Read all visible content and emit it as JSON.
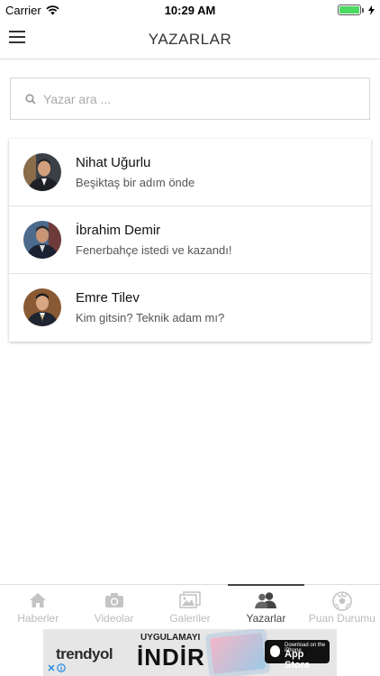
{
  "status_bar": {
    "carrier": "Carrier",
    "time": "10:29 AM",
    "battery_color": "#4cd964"
  },
  "nav": {
    "title": "YAZARLAR",
    "menu_icon": "hamburger-icon"
  },
  "search": {
    "placeholder": "Yazar ara ...",
    "icon": "search-icon"
  },
  "authors": [
    {
      "name": "Nihat Uğurlu",
      "article": "Beşiktaş bir adım önde"
    },
    {
      "name": "İbrahim Demir",
      "article": "Fenerbahçe istedi ve kazandı!"
    },
    {
      "name": "Emre Tilev",
      "article": "Kim gitsin? Teknik adam mı?"
    }
  ],
  "tabs": [
    {
      "label": "Haberler",
      "icon": "home-icon",
      "active": false
    },
    {
      "label": "Videolar",
      "icon": "camera-icon",
      "active": false
    },
    {
      "label": "Galeriler",
      "icon": "gallery-icon",
      "active": false
    },
    {
      "label": "Yazarlar",
      "icon": "users-icon",
      "active": true
    },
    {
      "label": "Puan Durumu",
      "icon": "soccer-ball-icon",
      "active": false
    }
  ],
  "ad": {
    "brand_prefix": "trendyol",
    "headline_top": "UYGULAMAYI",
    "headline": "İNDİR",
    "store_small": "Download on the iPhone",
    "store_big": "App Store",
    "accent_color": "#f27a1a"
  }
}
